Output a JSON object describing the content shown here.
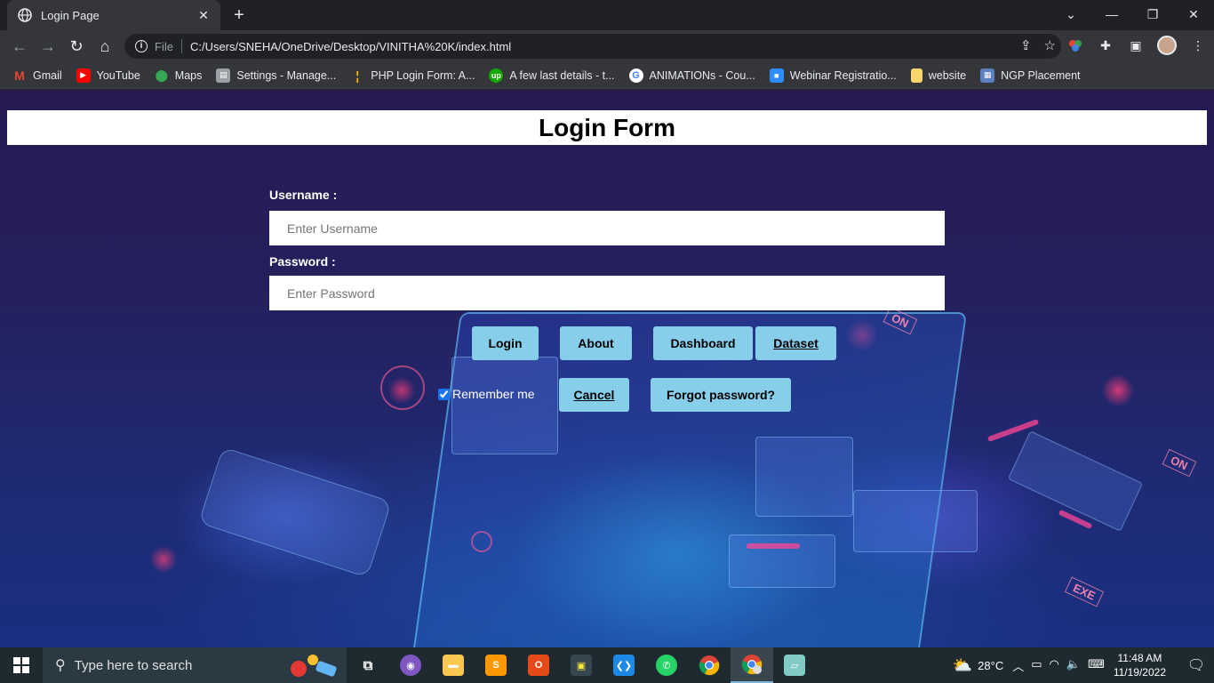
{
  "browser": {
    "tab_title": "Login Page",
    "new_tab_label": "+",
    "address": {
      "scheme_label": "File",
      "url": "C:/Users/SNEHA/OneDrive/Desktop/VINITHA%20K/index.html"
    },
    "bookmarks": [
      {
        "label": "Gmail",
        "icon": "gmail-icon",
        "color": "#ea4335"
      },
      {
        "label": "YouTube",
        "icon": "youtube-icon",
        "color": "#ff0000"
      },
      {
        "label": "Maps",
        "icon": "maps-icon",
        "color": "#34a853"
      },
      {
        "label": "Settings - Manage...",
        "icon": "settings-page-icon",
        "color": "#9aa0a6"
      },
      {
        "label": "PHP Login Form: A...",
        "icon": "php-icon",
        "color": "#f4b400"
      },
      {
        "label": "A few last details - t...",
        "icon": "upwork-icon",
        "color": "#14a800"
      },
      {
        "label": "ANIMATIONs - Cou...",
        "icon": "google-icon",
        "color": "#4285f4"
      },
      {
        "label": "Webinar Registratio...",
        "icon": "zoom-icon",
        "color": "#2d8cff"
      },
      {
        "label": "website",
        "icon": "folder-icon",
        "color": "#f9d56e"
      },
      {
        "label": "NGP Placement",
        "icon": "ngp-icon",
        "color": "#5b7fbf"
      }
    ]
  },
  "page": {
    "title": "Login Form",
    "username": {
      "label": "Username :",
      "placeholder": "Enter Username",
      "value": ""
    },
    "password": {
      "label": "Password :",
      "placeholder": "Enter Password",
      "value": ""
    },
    "buttons": {
      "login": "Login",
      "about": "About",
      "dashboard": "Dashboard",
      "dataset": "Dataset",
      "cancel": "Cancel",
      "forgot": "Forgot password?"
    },
    "remember": {
      "label": "Remember me",
      "checked": true
    },
    "colors": {
      "button_bg": "#87ceeb",
      "header_bg": "#ffffff"
    }
  },
  "taskbar": {
    "search_placeholder": "Type here to search",
    "apps": [
      "task-view-icon",
      "messenger-icon",
      "file-explorer-icon",
      "sublime-text-icon",
      "office-icon",
      "media-app-icon",
      "vscode-icon",
      "whatsapp-icon",
      "chrome-icon",
      "chrome-profile-icon",
      "notepad-icon"
    ],
    "weather": "28°C",
    "time": "11:48 AM",
    "date": "11/19/2022"
  }
}
